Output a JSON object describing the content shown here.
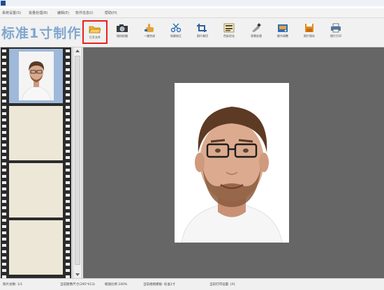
{
  "menu": [
    "系统设置(S)",
    "批量处理(B)",
    "编辑(E)",
    "软件信息(I)",
    "帮助(H)"
  ],
  "brand": "标准1寸制作",
  "toolbar": [
    {
      "label": "打开文件",
      "icon": "folder-open-icon",
      "highlighted": true
    },
    {
      "label": "相机拍摄",
      "icon": "camera-icon",
      "highlighted": false
    },
    {
      "label": "一键完成",
      "icon": "hand-pointer-icon",
      "highlighted": false
    },
    {
      "label": "轮廓修正",
      "icon": "scissors-icon",
      "highlighted": false
    },
    {
      "label": "照片裁切",
      "icon": "crop-icon",
      "highlighted": false
    },
    {
      "label": "色彩优化",
      "icon": "color-adjust-icon",
      "highlighted": false
    },
    {
      "label": "背景处理",
      "icon": "background-brush-icon",
      "highlighted": false
    },
    {
      "label": "细节调整",
      "icon": "detail-adjust-icon",
      "highlighted": false
    },
    {
      "label": "照片保存",
      "icon": "floppy-save-icon",
      "highlighted": false
    },
    {
      "label": "照片打印",
      "icon": "printer-icon",
      "highlighted": false
    }
  ],
  "status": {
    "count": "照片总数: 1/1",
    "size": "当前图像尺寸(295*413)",
    "zoom": "缩放比例 100%",
    "mode": "当前规格模板: 标准1寸",
    "printer": "当前打印设置: [A]"
  },
  "colors": {
    "highlight": "#e8211d",
    "brand": "#7fa6cf",
    "canvas": "#666666"
  }
}
